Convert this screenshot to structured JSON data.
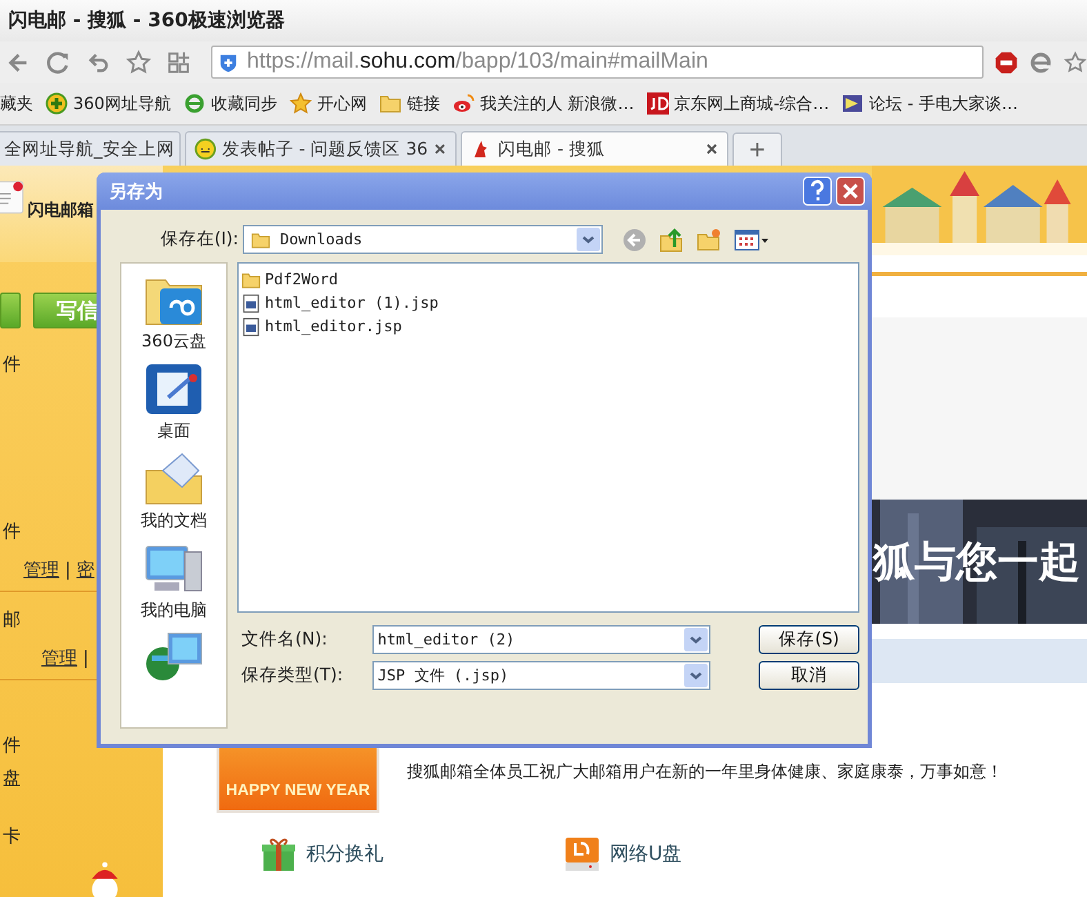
{
  "window": {
    "title": "闪电邮 - 搜狐 - 360极速浏览器"
  },
  "address_bar": {
    "prefix": "https://mail.",
    "domain": "sohu.com",
    "path": "/bapp/103/main#mailMain"
  },
  "bookmarks": [
    {
      "label": "藏夹",
      "kind": "none"
    },
    {
      "label": "360网址导航",
      "kind": "plus"
    },
    {
      "label": "收藏同步",
      "kind": "e"
    },
    {
      "label": "开心网",
      "kind": "star"
    },
    {
      "label": "链接",
      "kind": "folder"
    },
    {
      "label": "我关注的人 新浪微…",
      "kind": "weibo"
    },
    {
      "label": "京东网上商城-综合…",
      "kind": "jd"
    },
    {
      "label": "论坛 - 手电大家谈…",
      "kind": "flag"
    }
  ],
  "tabs": [
    {
      "label": "全网址导航_安全上网",
      "kind": "none",
      "selected": false
    },
    {
      "label": "发表帖子 - 问题反馈区 36",
      "kind": "smiley",
      "selected": false
    },
    {
      "label": "闪电邮 - 搜狐",
      "kind": "sohu",
      "selected": true
    }
  ],
  "new_tab": "+",
  "sidebar": {
    "logo": "闪电邮箱",
    "compose": "写信",
    "sections": [
      {
        "items": [
          [
            {
              "text": "件",
              "link": false
            }
          ],
          [
            {
              "text": "件",
              "link": false
            }
          ],
          [
            {
              "text": "管理",
              "link": true
            },
            {
              "text": "|",
              "link": false
            },
            {
              "text": "密",
              "link": true
            }
          ]
        ]
      },
      {
        "items": [
          [
            {
              "text": "邮",
              "link": false
            }
          ],
          [
            {
              "text": "管理",
              "link": true
            },
            {
              "text": "|",
              "link": false
            }
          ]
        ]
      },
      {
        "items": [
          [
            {
              "text": "件",
              "link": false
            }
          ],
          [
            {
              "text": "盘",
              "link": false
            }
          ],
          [
            {
              "text": "卡",
              "link": false
            }
          ]
        ]
      }
    ]
  },
  "main": {
    "banner_text": "狐与您一起",
    "greeting": {
      "image_text": "HAPPY NEW YEAR",
      "message": "搜狐邮箱全体员工祝广大邮箱用户在新的一年里身体健康、家庭康泰，万事如意！"
    },
    "shortcuts": [
      {
        "label": "积分换礼",
        "kind": "gift"
      },
      {
        "label": "网络U盘",
        "kind": "disk"
      }
    ]
  },
  "dialog": {
    "title": "另存为",
    "save_in_label": "保存在(I):",
    "location": "Downloads",
    "places": [
      {
        "label": "360云盘",
        "kind": "cloud"
      },
      {
        "label": "桌面",
        "kind": "desktop"
      },
      {
        "label": "我的文档",
        "kind": "documents"
      },
      {
        "label": "我的电脑",
        "kind": "computer"
      },
      {
        "kind": "network"
      }
    ],
    "files": [
      {
        "name": "Pdf2Word",
        "kind": "folder"
      },
      {
        "name": "html_editor (1).jsp",
        "kind": "jsp"
      },
      {
        "name": "html_editor.jsp",
        "kind": "jsp"
      }
    ],
    "filename_label": "文件名(N):",
    "filename": "html_editor (2)",
    "filetype_label": "保存类型(T):",
    "filetype": "JSP 文件 (.jsp)",
    "save_button": "保存(S)",
    "cancel_button": "取消"
  }
}
